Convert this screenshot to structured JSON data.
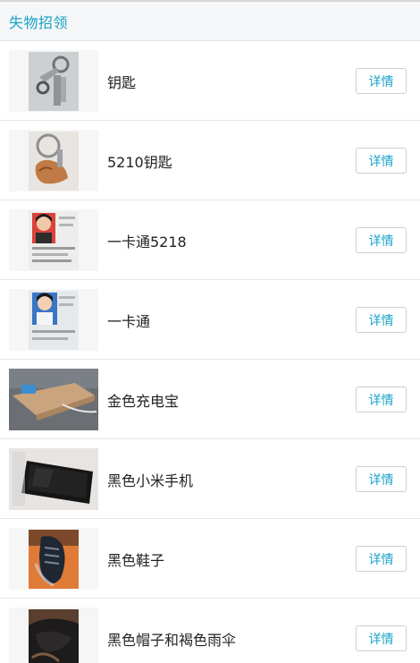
{
  "header": {
    "title": "失物招领"
  },
  "detail_label": "详情",
  "items": [
    {
      "name": "钥匙",
      "image": "keys-photo"
    },
    {
      "name": "5210钥匙",
      "image": "keys-with-horse-keychain-photo"
    },
    {
      "name": "一卡通5218",
      "image": "id-card-photo"
    },
    {
      "name": "一卡通",
      "image": "id-card-photo"
    },
    {
      "name": "金色充电宝",
      "image": "power-bank-photo"
    },
    {
      "name": "黑色小米手机",
      "image": "phone-photo"
    },
    {
      "name": "黑色鞋子",
      "image": "shoe-photo"
    },
    {
      "name": "黑色帽子和褐色雨伞",
      "image": "hat-umbrella-photo"
    }
  ]
}
